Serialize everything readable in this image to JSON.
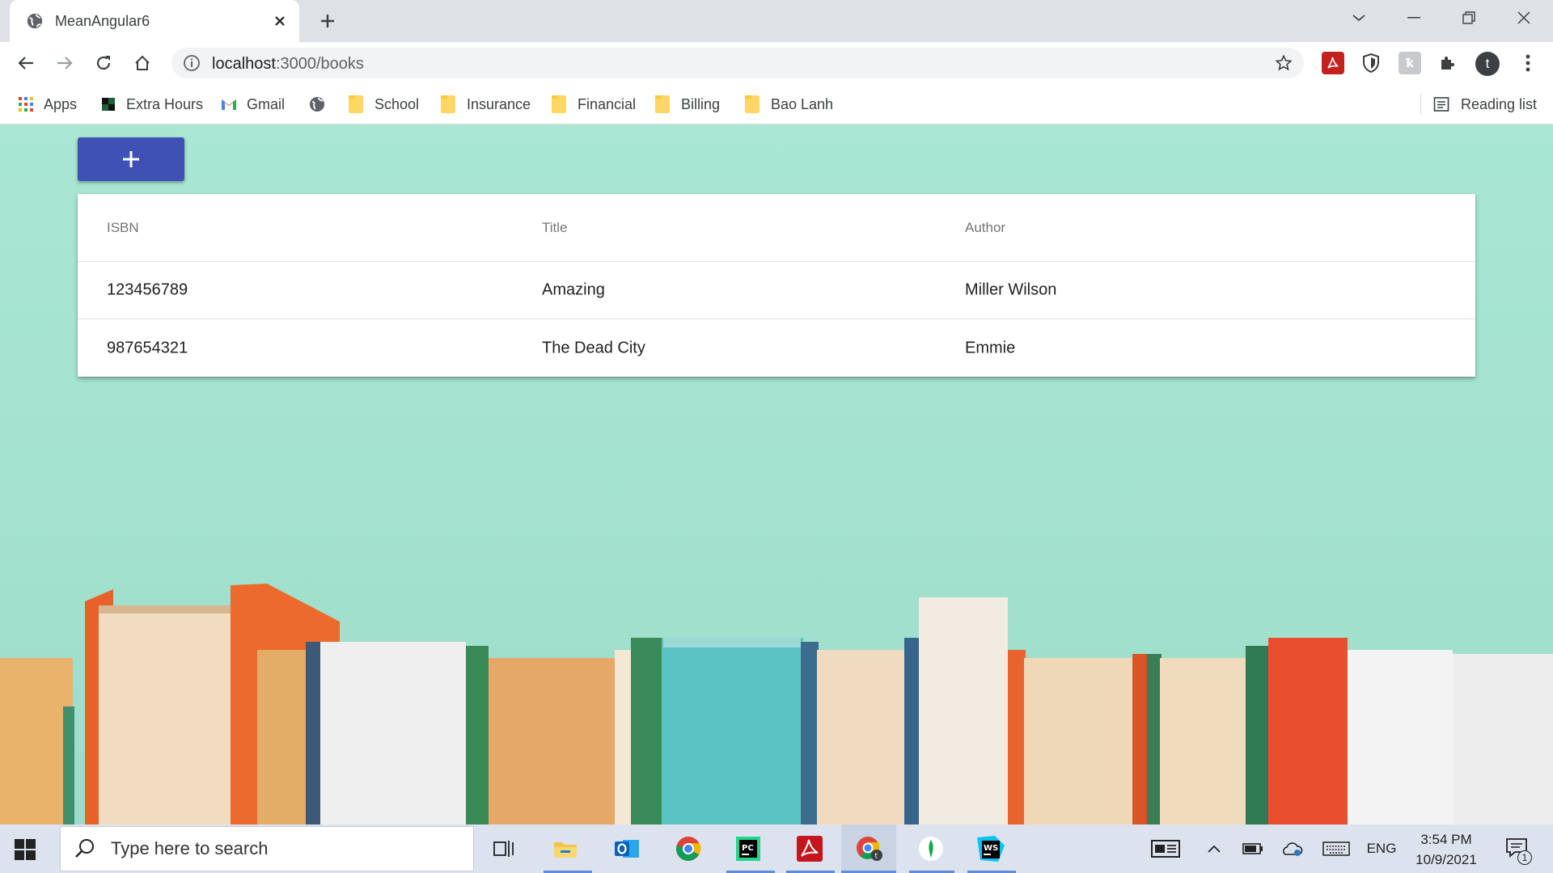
{
  "browser": {
    "tab_title": "MeanAngular6",
    "url_host": "localhost",
    "url_path": ":3000/books",
    "profile_initial": "t",
    "bookmarks": [
      {
        "label": "Apps",
        "icon": "apps-grid-icon"
      },
      {
        "label": "Extra Hours",
        "icon": "extra-hours-icon"
      },
      {
        "label": "Gmail",
        "icon": "gmail-icon"
      },
      {
        "label": "",
        "icon": "globe-icon"
      },
      {
        "label": "School",
        "icon": "folder-icon"
      },
      {
        "label": "Insurance",
        "icon": "folder-icon"
      },
      {
        "label": "Financial",
        "icon": "folder-icon"
      },
      {
        "label": "Billing",
        "icon": "folder-icon"
      },
      {
        "label": "Bao Lanh",
        "icon": "folder-icon"
      }
    ],
    "reading_list_label": "Reading list"
  },
  "app": {
    "add_button_icon": "plus-icon",
    "table": {
      "columns": [
        "ISBN",
        "Title",
        "Author"
      ],
      "rows": [
        {
          "isbn": "123456789",
          "title": "Amazing",
          "author": "Miller Wilson"
        },
        {
          "isbn": "987654321",
          "title": "The Dead City",
          "author": "Emmie"
        }
      ]
    }
  },
  "taskbar": {
    "search_placeholder": "Type here to search",
    "language": "ENG",
    "time": "3:54 PM",
    "date": "10/9/2021",
    "notification_count": "1",
    "apps": [
      "task-view-icon",
      "file-explorer-icon",
      "outlook-icon",
      "chrome-icon",
      "pycharm-icon",
      "acrobat-icon",
      "chrome-profile-icon",
      "mongodb-icon",
      "webstorm-icon"
    ]
  },
  "colors": {
    "accent": "#3f51b5",
    "page_background": "#a6e3d1",
    "tab_strip": "#dee1e6",
    "taskbar": "#dde3ee"
  }
}
